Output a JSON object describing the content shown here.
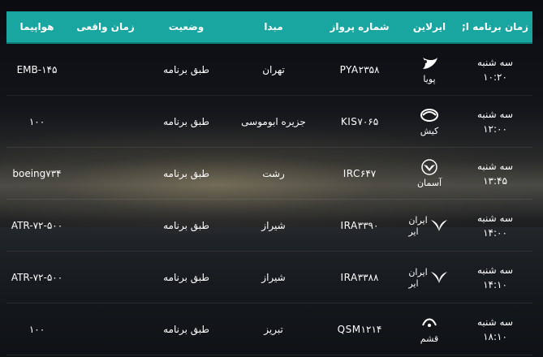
{
  "header": {
    "scheduled": "زمان برنامه ا;",
    "airline": "ایرلاین",
    "flight_no": "شماره پرواز",
    "origin": "مبدا",
    "status": "وضعیت",
    "actual": "زمان واقعی",
    "aircraft": "هواپیما"
  },
  "rows": [
    {
      "day": "سه شنبه",
      "time": "۱۰:۲۰",
      "airline": "پویا",
      "airline2": "",
      "flight": "PYA۲۳۵۸",
      "origin": "تهران",
      "status": "طبق برنامه",
      "actual": "",
      "aircraft": "EMB-۱۴۵"
    },
    {
      "day": "سه شنبه",
      "time": "۱۲:۰۰",
      "airline": "کیش",
      "airline2": "",
      "flight": "KIS۷۰۶۵",
      "origin": "جزیره ابوموسی",
      "status": "طبق برنامه",
      "actual": "",
      "aircraft": "۱۰۰"
    },
    {
      "day": "سه شنبه",
      "time": "۱۳:۴۵",
      "airline": "آسمان",
      "airline2": "",
      "flight": "IRC۶۴۷",
      "origin": "رشت",
      "status": "طبق برنامه",
      "actual": "",
      "aircraft": "boeing۷۳۴"
    },
    {
      "day": "سه شنبه",
      "time": "۱۴:۰۰",
      "airline": "ایران",
      "airline2": "ایر",
      "flight": "IRA۳۳۹۰",
      "origin": "شیراز",
      "status": "طبق برنامه",
      "actual": "",
      "aircraft": "ATR-۷۲-۵۰۰"
    },
    {
      "day": "سه شنبه",
      "time": "۱۴:۱۰",
      "airline": "ایران",
      "airline2": "ایر",
      "flight": "IRA۳۳۸۸",
      "origin": "شیراز",
      "status": "طبق برنامه",
      "actual": "",
      "aircraft": "ATR-۷۲-۵۰۰"
    },
    {
      "day": "سه شنبه",
      "time": "۱۸:۱۰",
      "airline": "قشم",
      "airline2": "",
      "flight": "QSM۱۲۱۴",
      "origin": "تبریز",
      "status": "طبق برنامه",
      "actual": "",
      "aircraft": "۱۰۰"
    }
  ],
  "icons": [
    "pouya-logo-icon",
    "kish-logo-icon",
    "aseman-logo-icon",
    "iranair-logo-icon",
    "iranair-logo-icon",
    "qeshm-logo-icon"
  ]
}
